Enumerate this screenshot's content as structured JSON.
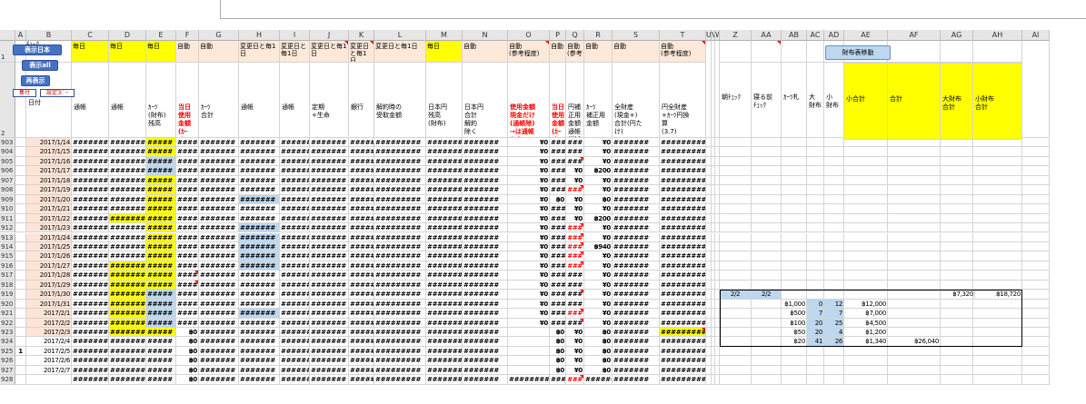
{
  "columns": [
    "A",
    "B",
    "C",
    "D",
    "E",
    "F",
    "G",
    "H",
    "I",
    "J",
    "K",
    "L",
    "M",
    "N",
    "O",
    "P",
    "Q",
    "R",
    "S",
    "T",
    "U",
    "V",
    "W",
    "Z",
    "AA",
    "AB",
    "AC",
    "AD",
    "AE",
    "AF",
    "AG",
    "AH",
    "AI"
  ],
  "buttons": {
    "show_jp": "表示日本",
    "show_all": "表示all",
    "redisplay": "再表示",
    "small1": "集付",
    "small2": "設定ｺﾋﾟｰ",
    "wallet_move": "財布表移動"
  },
  "row1": {
    "C": "毎日",
    "D": "毎日",
    "E": "毎日",
    "F": "自動",
    "G": "自動",
    "H": "変更日と毎1日",
    "I": "変更日と毎1日",
    "J": "変更日と毎1日",
    "K": "変更日と毎1日",
    "L": "変更日と毎1日",
    "M": "毎日",
    "N": "自動",
    "O": "自動\n(参考程度)",
    "P": "自動",
    "Q": "自動\n(参考",
    "R": "自動",
    "S": "自動",
    "T": "自動\n(参考程度)",
    "B": "ﾁｪｯｸ"
  },
  "row2": {
    "B": "日付",
    "C": "通帳",
    "D": "通帳",
    "E": "ｶｰﾂ\n(財布)\n残高",
    "F": "当日\n使用\n金額\n(ｶｰ\nﾂ)",
    "G": "ｶｰﾂ\n合計",
    "H": "通帳",
    "I": "通帳",
    "J": "定期\n+生命",
    "K": "銀行",
    "L": "解約時の\n受取金額",
    "M": "日本円\n残高\n(財布)",
    "N": "日本円\n合計\n解約\n除く",
    "O": "使用金額\n現金だけ\n(通帳除)\n→は通帳\nから",
    "P": "当日\n使用\n金額\n(ｶｰ\nﾂ)",
    "Q": "円補\n正用\n金額\n通帳\n増減\n→表\n示は\n増加",
    "R": "ｶｰﾂ\n補正用\n金額",
    "S": "全財産\n(現金+)\n合計(円た\nけ)",
    "T": "円全財産\n+ｶｰﾂ円換\n算\n(3.7)",
    "Z": "朝ﾁｪｯｸ",
    "AA": "寝る前\nﾁｪｯｸ",
    "AB": "ｶｰﾂ札",
    "AC": "大\n財布",
    "AD": "小\n財布",
    "AE": "小合計",
    "AF": "合計",
    "AG": "大財布\n合計",
    "AH": "小財布\n合計"
  },
  "rows": [
    {
      "n": "903",
      "date": "2017/1/14"
    },
    {
      "n": "904",
      "date": "2017/1/15"
    },
    {
      "n": "905",
      "date": "2017/1/16"
    },
    {
      "n": "906",
      "date": "2017/1/17"
    },
    {
      "n": "907",
      "date": "2017/1/18"
    },
    {
      "n": "908",
      "date": "2017/1/19"
    },
    {
      "n": "909",
      "date": "2017/1/20"
    },
    {
      "n": "910",
      "date": "2017/1/21"
    },
    {
      "n": "911",
      "date": "2017/1/22"
    },
    {
      "n": "912",
      "date": "2017/1/23"
    },
    {
      "n": "913",
      "date": "2017/1/24"
    },
    {
      "n": "914",
      "date": "2017/1/25"
    },
    {
      "n": "915",
      "date": "2017/1/26"
    },
    {
      "n": "916",
      "date": "2017/1/27"
    },
    {
      "n": "917",
      "date": "2017/1/28"
    },
    {
      "n": "918",
      "date": "2017/1/29"
    },
    {
      "n": "919",
      "date": "2017/1/30"
    },
    {
      "n": "920",
      "date": "2017/1/31"
    },
    {
      "n": "921",
      "date": "2017/2/1"
    },
    {
      "n": "922",
      "date": "2017/2/2"
    },
    {
      "n": "923",
      "date": "2017/2/3"
    },
    {
      "n": "924",
      "date": "2017/2/4"
    },
    {
      "n": "925",
      "date": "2017/2/5"
    },
    {
      "n": "926",
      "date": "2017/2/6"
    },
    {
      "n": "927",
      "date": "2017/2/7"
    },
    {
      "n": "928",
      "date": ""
    }
  ],
  "o_col": [
    "¥0",
    "¥0",
    "¥0",
    "¥0",
    "¥0",
    "¥0",
    "¥0",
    "¥0",
    "¥0",
    "¥0",
    "¥0",
    "¥0",
    "¥0",
    "¥0",
    "¥0",
    "¥0",
    "¥0",
    "¥0",
    "¥0",
    "¥0",
    "",
    "",
    "",
    "",
    "",
    ""
  ],
  "p_col": [
    "###",
    "###",
    "###",
    "###",
    "###",
    "###",
    "฿0",
    "###",
    "###",
    "###",
    "###",
    "###",
    "###",
    "###",
    "###",
    "###",
    "###",
    "###",
    "###",
    "###",
    "฿0",
    "฿0",
    "฿0",
    "฿0",
    "฿0",
    "###"
  ],
  "q_col": [
    "###",
    "###",
    "###",
    "¥0",
    "¥0",
    "###",
    "¥0",
    "¥0",
    "¥0",
    "###",
    "###",
    "###",
    "###",
    "###",
    "###",
    "###",
    "###",
    "###",
    "###",
    "###",
    "¥0",
    "¥0",
    "¥0",
    "¥0",
    "¥0",
    "###"
  ],
  "r_col": [
    "¥0",
    "¥0",
    "¥0",
    "฿200",
    "¥0",
    "¥0",
    "฿0",
    "¥0",
    "฿200",
    "¥0",
    "¥0",
    "฿940",
    "¥0",
    "¥0",
    "¥0",
    "¥0",
    "¥0",
    "¥0",
    "¥0",
    "¥0",
    "฿0",
    "฿0",
    "฿0",
    "฿0",
    "฿0",
    ""
  ],
  "a_col_row925": "1",
  "wallet": {
    "check_morning": "2/2",
    "check_night": "2/2",
    "ag_total": "฿7,320",
    "ah_total": "฿18,720",
    "rows": [
      {
        "ab": "฿1,000",
        "ac": "0",
        "ad": "12",
        "ae": "฿12,000",
        "af": ""
      },
      {
        "ab": "฿500",
        "ac": "7",
        "ad": "7",
        "ae": "฿7,000",
        "af": ""
      },
      {
        "ab": "฿100",
        "ac": "20",
        "ad": "25",
        "ae": "฿4,500",
        "af": ""
      },
      {
        "ab": "฿50",
        "ac": "20",
        "ad": "4",
        "ae": "฿1,200",
        "af": ""
      },
      {
        "ab": "฿20",
        "ac": "41",
        "ad": "26",
        "ae": "฿1,340",
        "af": "฿26,040"
      }
    ]
  },
  "mask7": "#######",
  "mask4": "#####",
  "mask3": "###",
  "mask9": "#########"
}
